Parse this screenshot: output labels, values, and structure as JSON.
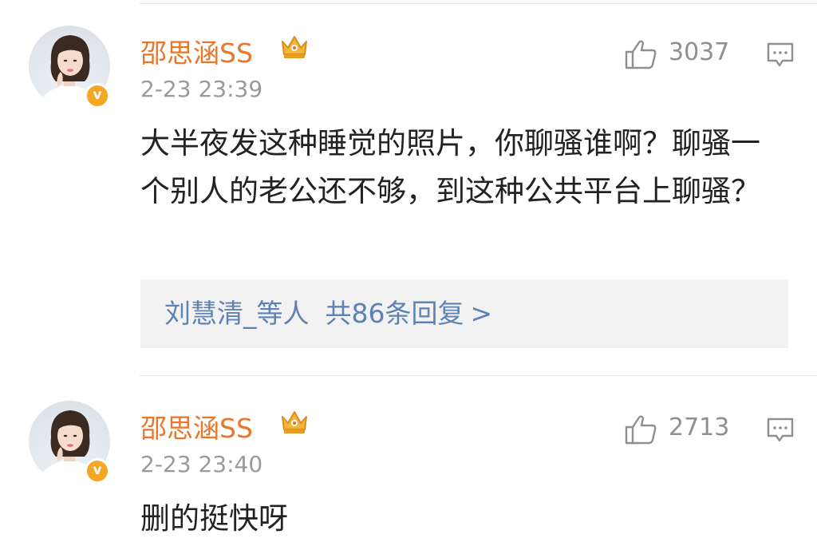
{
  "comments": [
    {
      "username": "邵思涵SS",
      "timestamp": "2-23 23:39",
      "likes": "3037",
      "text": "大半夜发这种睡觉的照片，你聊骚谁啊？聊骚一个别人的老公还不够，到这种公共平台上聊骚？",
      "verified_mark": "v",
      "replies": {
        "users": "刘慧清_等人",
        "summary": "共86条回复",
        "arrow": ">"
      }
    },
    {
      "username": "邵思涵SS",
      "timestamp": "2-23 23:40",
      "likes": "2713",
      "text": "删的挺快呀",
      "verified_mark": "v"
    }
  ],
  "icons": {
    "like": "thumbs-up-icon",
    "reply": "comment-bubble-icon",
    "crown": "crown-badge-icon",
    "verified": "verified-v-badge"
  },
  "colors": {
    "username": "#e8762b",
    "link": "#5d82b3",
    "verified": "#f5a623",
    "reply_box_bg": "#f2f2f2"
  }
}
